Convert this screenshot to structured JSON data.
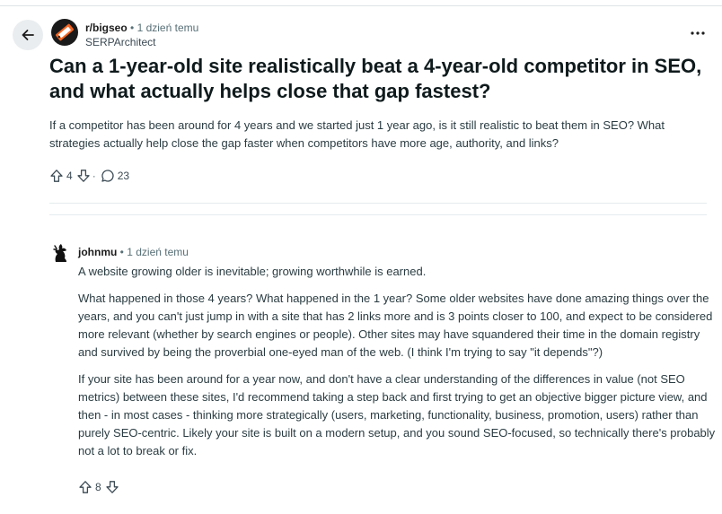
{
  "post": {
    "subreddit": "r/bigseo",
    "separator": "•",
    "time": "1 dzień temu",
    "author": "SERPArchitect",
    "title": "Can a 1-year-old site realistically beat a 4-year-old competitor in SEO, and what actually helps close that gap fastest?",
    "body": "If a competitor has been around for 4 years and we started just 1 year ago, is it still realistic to beat them in SEO? What strategies actually help close the gap faster when competitors have more age, authority, and links?",
    "votes": "4",
    "dot": "·",
    "comments": "23",
    "icons": {
      "back": "arrow-left-icon",
      "more": "more-horizontal-icon",
      "upvote": "arrow-up-icon",
      "downvote": "arrow-down-icon",
      "comment": "speech-bubble-icon"
    }
  },
  "comment": {
    "user": "johnmu",
    "separator": "•",
    "time": "1 dzień temu",
    "paragraphs": [
      "A website growing older is inevitable; growing worthwhile is earned.",
      "What happened in those 4 years? What happened in the 1 year? Some older websites have done amazing things over the years, and you can't just jump in with a site that has 2 links more and is 3 points closer to 100, and expect to be considered more relevant (whether by search engines or people). Other sites may have squandered their time in the domain registry and survived by being the proverbial one-eyed man of the web. (I think I'm trying to say \"it depends\"?)",
      "If your site has been around for a year now, and don't have a clear understanding of the differences in value (not SEO metrics) between these sites, I'd recommend taking a step back and first trying to get an objective bigger picture view, and then - in most cases - thinking more strategically (users, marketing, functionality, business, promotion, users) rather than purely SEO-centric. Likely your site is built on a modern setup, and you sound SEO-focused, so technically there's probably not a lot to break or fix."
    ],
    "votes": "8"
  },
  "colors": {
    "meta_gray": "#576f76",
    "title": "#0f1a1c",
    "body": "#2a3c42",
    "back_bg": "#eaedef"
  }
}
